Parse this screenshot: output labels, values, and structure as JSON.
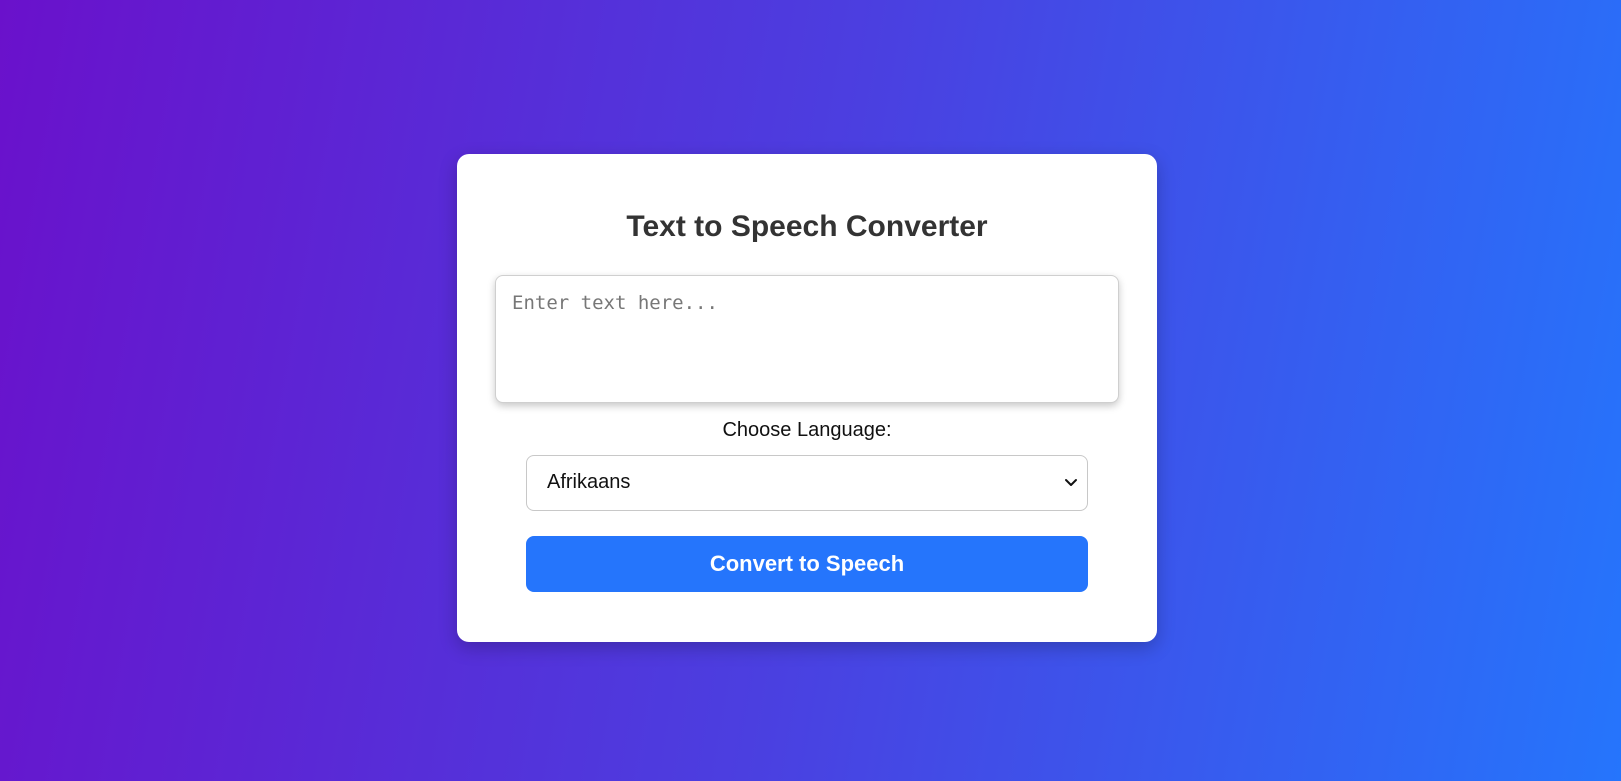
{
  "app": {
    "title": "Text to Speech Converter"
  },
  "input": {
    "placeholder": "Enter text here...",
    "value": ""
  },
  "language": {
    "label": "Choose Language:",
    "selected": "Afrikaans",
    "icon": "chevron-down-icon"
  },
  "actions": {
    "convert_label": "Convert to Speech"
  },
  "colors": {
    "gradient_start": "#6a11cb",
    "gradient_end": "#2575fc",
    "button": "#2575fc",
    "card": "#ffffff",
    "title_text": "#333333"
  }
}
